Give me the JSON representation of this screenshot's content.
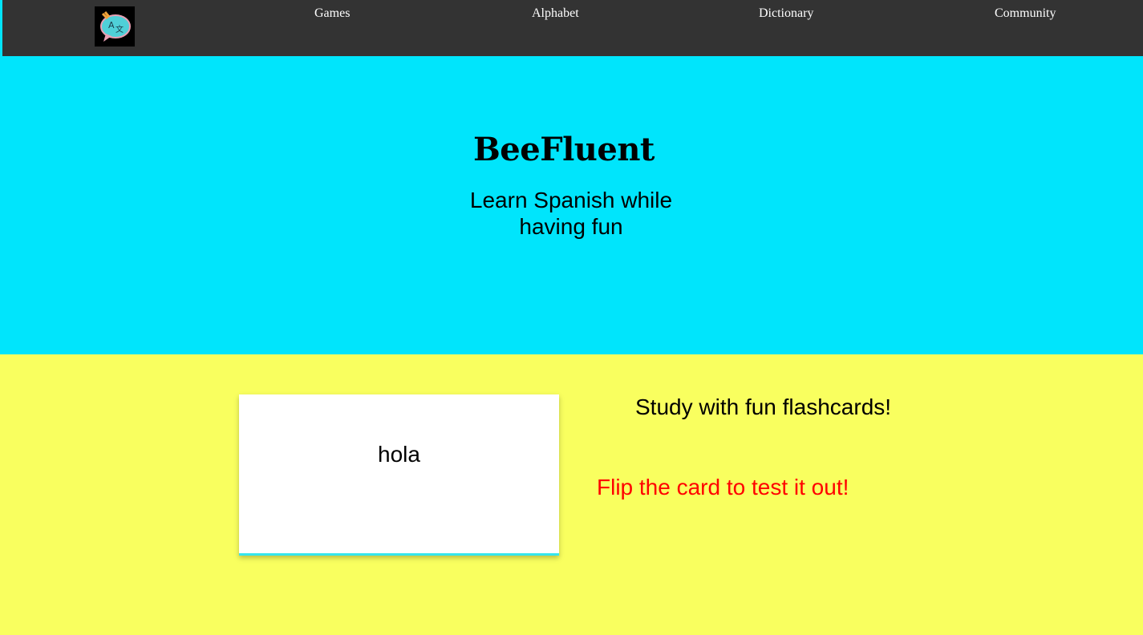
{
  "nav": {
    "logo_icon": "translate-speech-bubble-icon",
    "links": [
      {
        "label": "Games"
      },
      {
        "label": "Alphabet"
      },
      {
        "label": "Dictionary"
      },
      {
        "label": "Community"
      }
    ]
  },
  "hero": {
    "title": "BeeFluent",
    "subtitle": "Learn Spanish while having fun",
    "background": "#00e5fc"
  },
  "flashcards": {
    "background": "#f9ff5f",
    "card_word": "hola",
    "heading": "Study with fun flashcards!",
    "prompt": "Flip the card to test it out!",
    "prompt_color": "#ff0000"
  }
}
